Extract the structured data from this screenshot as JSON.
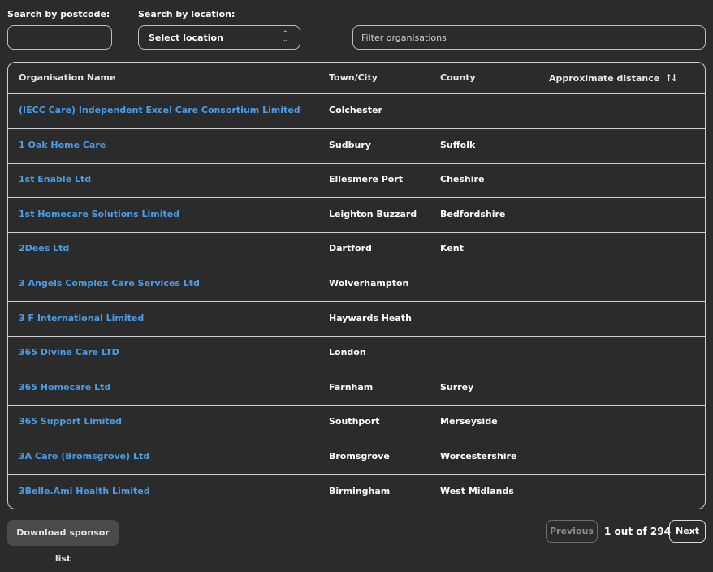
{
  "filters": {
    "postcode_label": "Search by postcode:",
    "postcode_value": "",
    "location_label": "Search by location:",
    "location_selected": "Select location",
    "org_filter_placeholder": "Filter organisations"
  },
  "table": {
    "headers": {
      "org": "Organisation Name",
      "town": "Town/City",
      "county": "County",
      "distance": "Approximate distance"
    },
    "rows": [
      {
        "org": "(IECC Care) Independent Excel Care Consortium Limited",
        "town": "Colchester",
        "county": ""
      },
      {
        "org": "1 Oak Home Care",
        "town": "Sudbury",
        "county": "Suffolk"
      },
      {
        "org": "1st Enable Ltd",
        "town": "Ellesmere Port",
        "county": "Cheshire"
      },
      {
        "org": "1st Homecare Solutions Limited",
        "town": "Leighton Buzzard",
        "county": "Bedfordshire"
      },
      {
        "org": "2Dees Ltd",
        "town": "Dartford",
        "county": "Kent"
      },
      {
        "org": "3 Angels Complex Care Services Ltd",
        "town": "Wolverhampton",
        "county": ""
      },
      {
        "org": "3 F International Limited",
        "town": "Haywards Heath",
        "county": ""
      },
      {
        "org": "365 Divine Care LTD",
        "town": "London",
        "county": ""
      },
      {
        "org": "365 Homecare Ltd",
        "town": "Farnham",
        "county": "Surrey"
      },
      {
        "org": "365 Support Limited",
        "town": "Southport",
        "county": "Merseyside"
      },
      {
        "org": "3A Care (Bromsgrove) Ltd",
        "town": "Bromsgrove",
        "county": "Worcestershire"
      },
      {
        "org": "3Belle.Ami Health Limited",
        "town": "Birmingham",
        "county": "West Midlands"
      }
    ]
  },
  "footer": {
    "download_label": "Download sponsor list",
    "previous_label": "Previous",
    "page_info": "1 out of 294",
    "next_label": "Next"
  },
  "colors": {
    "background": "#2b2b2b",
    "link": "#4a9de8",
    "border": "#cfcfcf"
  },
  "icons": {
    "select": "chevron-up-down-icon",
    "sort": "sort-arrows-icon"
  }
}
